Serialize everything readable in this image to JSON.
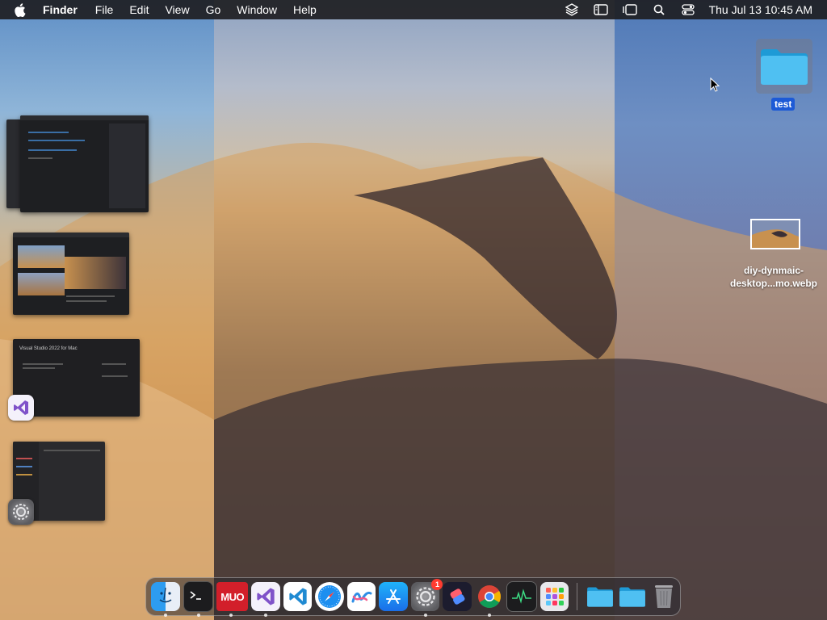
{
  "menubar": {
    "app_name": "Finder",
    "items": [
      "File",
      "Edit",
      "View",
      "Go",
      "Window",
      "Help"
    ],
    "clock": "Thu Jul 13  10:45 AM",
    "status_icons": [
      "layers-icon",
      "sidebar-icon",
      "stage-manager-icon",
      "search-icon",
      "control-center-icon"
    ]
  },
  "desktop": {
    "folder_label": "test",
    "file_label_line1": "diy-dynmaic-",
    "file_label_line2": "desktop...mo.webp"
  },
  "stage_manager": {
    "groups": [
      {
        "app_icon": "none"
      },
      {
        "app_icon": "none"
      },
      {
        "app_icon": "visual-studio-icon"
      },
      {
        "app_icon": "system-settings-icon"
      }
    ],
    "window_title_2": "Visual Studio 2022 for Mac"
  },
  "dock": {
    "apps": [
      "finder-icon",
      "terminal-icon",
      "muo-icon",
      "visual-studio-icon",
      "vscode-icon",
      "safari-icon",
      "freeform-icon",
      "app-store-icon",
      "system-settings-icon",
      "shortcuts-icon",
      "chrome-icon",
      "activity-monitor-icon",
      "launchpad-icon"
    ],
    "badge_count": "1",
    "muo_label": "MUO",
    "folders": [
      "folder-icon",
      "folder-icon",
      "trash-icon"
    ]
  },
  "colors": {
    "menubar_bg": "#1e1e22",
    "selection_blue": "#1d5ad6",
    "folder_blue": "#3fb8f0",
    "badge_red": "#ff3b30"
  }
}
